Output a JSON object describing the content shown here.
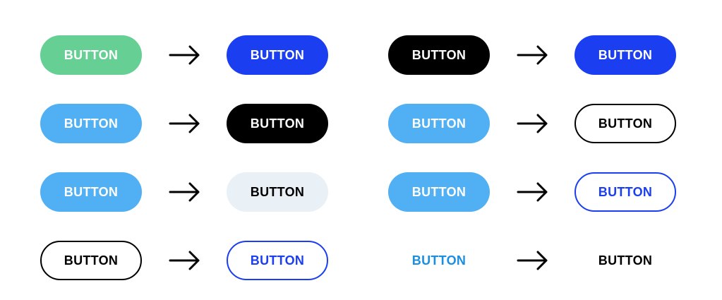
{
  "colors": {
    "green": "#66cf94",
    "blue": "#1b3ef0",
    "black": "#000000",
    "sky": "#50b0f3",
    "pale": "#e9f0f6",
    "text_blue": "#1a8fe0"
  },
  "left_column": [
    {
      "from_label": "BUTTON",
      "to_label": "BUTTON"
    },
    {
      "from_label": "BUTTON",
      "to_label": "BUTTON"
    },
    {
      "from_label": "BUTTON",
      "to_label": "BUTTON"
    },
    {
      "from_label": "BUTTON",
      "to_label": "BUTTON"
    }
  ],
  "right_column": [
    {
      "from_label": "BUTTON",
      "to_label": "BUTTON"
    },
    {
      "from_label": "BUTTON",
      "to_label": "BUTTON"
    },
    {
      "from_label": "BUTTON",
      "to_label": "BUTTON"
    },
    {
      "from_label": "BUTTON",
      "to_label": "BUTTON"
    }
  ],
  "arrow_icon": "arrow-right-icon"
}
